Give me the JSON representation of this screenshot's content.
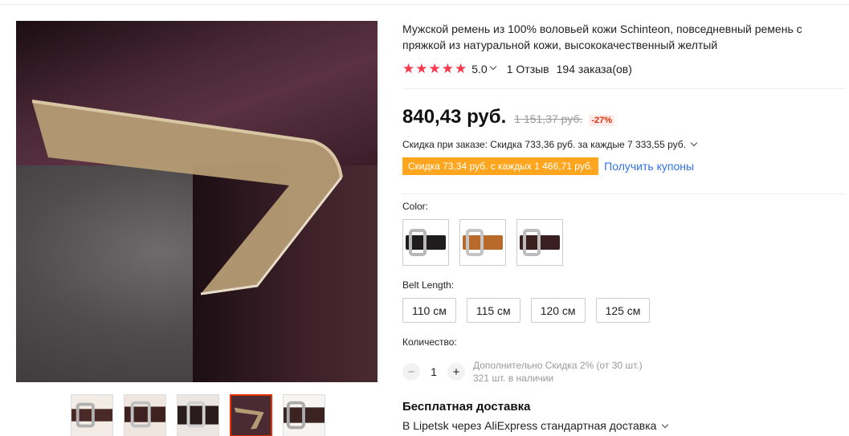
{
  "product": {
    "title": "Мужской ремень из 100% воловьей кожи Schinteon, повседневный ремень с пряжкой из натуральной кожи, высококачественный желтый",
    "rating": "5.0",
    "stars": 5,
    "reviews": "1 Отзыв",
    "orders": "194 заказа(ов)"
  },
  "price": {
    "current": "840,43 руб.",
    "old": "1 151,37 руб.",
    "discount": "-27%"
  },
  "promo": {
    "order_discount": "Скидка при заказе: Скидка 733,36 руб. за каждые 7 333,55 руб.",
    "coupon_tag": "Скидка 73,34 руб. с каждых 1 466,71 руб.",
    "coupon_link": "Получить купоны"
  },
  "options": {
    "color_label": "Color:",
    "colors": [
      {
        "name": "black",
        "hex": "#1e1c1d"
      },
      {
        "name": "tan",
        "hex": "#b86a2a"
      },
      {
        "name": "brown",
        "hex": "#3a1f20"
      }
    ],
    "length_label": "Belt Length:",
    "lengths": [
      "110 см",
      "115 см",
      "120 см",
      "125 см"
    ]
  },
  "quantity": {
    "label": "Количество:",
    "minus": "−",
    "plus": "+",
    "value": "1",
    "extra_discount": "Дополнительно Скидка 2% (от 30 шт.)",
    "stock": "321 шт. в наличии"
  },
  "shipping": {
    "title": "Бесплатная доставка",
    "details": "В Lipetsk через AliExpress стандартная доставка"
  },
  "gallery": {
    "thumbnail_count": 5,
    "active_index": 3
  },
  "colors": {
    "accent": "#e62e04",
    "star": "#f6394b",
    "coupon": "#ffa51e",
    "link": "#2e73e8"
  }
}
